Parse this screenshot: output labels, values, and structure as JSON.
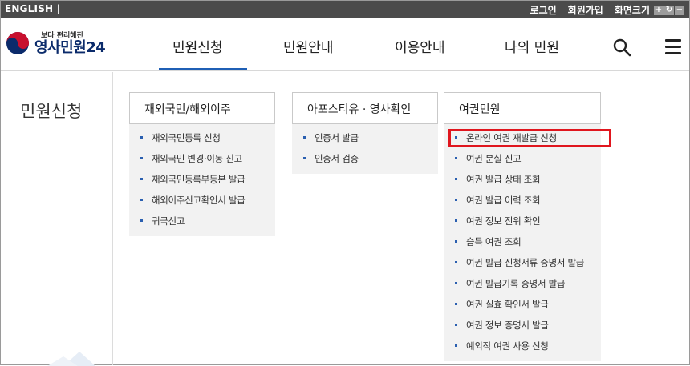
{
  "topbar": {
    "language": "ENGLISH |",
    "links": [
      "로그인",
      "회원가입",
      "화면크기"
    ],
    "zoom_buttons": [
      "+",
      "↻",
      "−"
    ]
  },
  "header": {
    "logo_sub": "보다 편리해진",
    "logo_main": "영사민원24",
    "menu": [
      "민원신청",
      "민원안내",
      "이용안내",
      "나의 민원"
    ],
    "active_menu": "민원신청"
  },
  "sidebar": {
    "title": "민원신청"
  },
  "columns": [
    {
      "heading": "재외국민/해외이주",
      "items": [
        "재외국민등록 신청",
        "재외국민 변경·이동 신고",
        "재외국민등록부등본 발급",
        "해외이주신고확인서 발급",
        "귀국신고"
      ]
    },
    {
      "heading": "아포스티유 · 영사확인",
      "items": [
        "인증서 발급",
        "인증서 검증"
      ]
    },
    {
      "heading": "여권민원",
      "items": [
        "온라인 여권 재발급 신청",
        "여권 분실 신고",
        "여권 발급 상태 조회",
        "여권 발급 이력 조회",
        "여권 정보 진위 확인",
        "습득 여권 조회",
        "여권 발급 신청서류 증명서 발급",
        "여권 발급기록 증명서 발급",
        "여권 실효 확인서 발급",
        "여권 정보 증명서 발급",
        "예외적 여권 사용 신청"
      ]
    }
  ],
  "colors": {
    "accent": "#1f5fb5",
    "highlight": "#e0161e",
    "topbar": "#4b4b4b"
  }
}
